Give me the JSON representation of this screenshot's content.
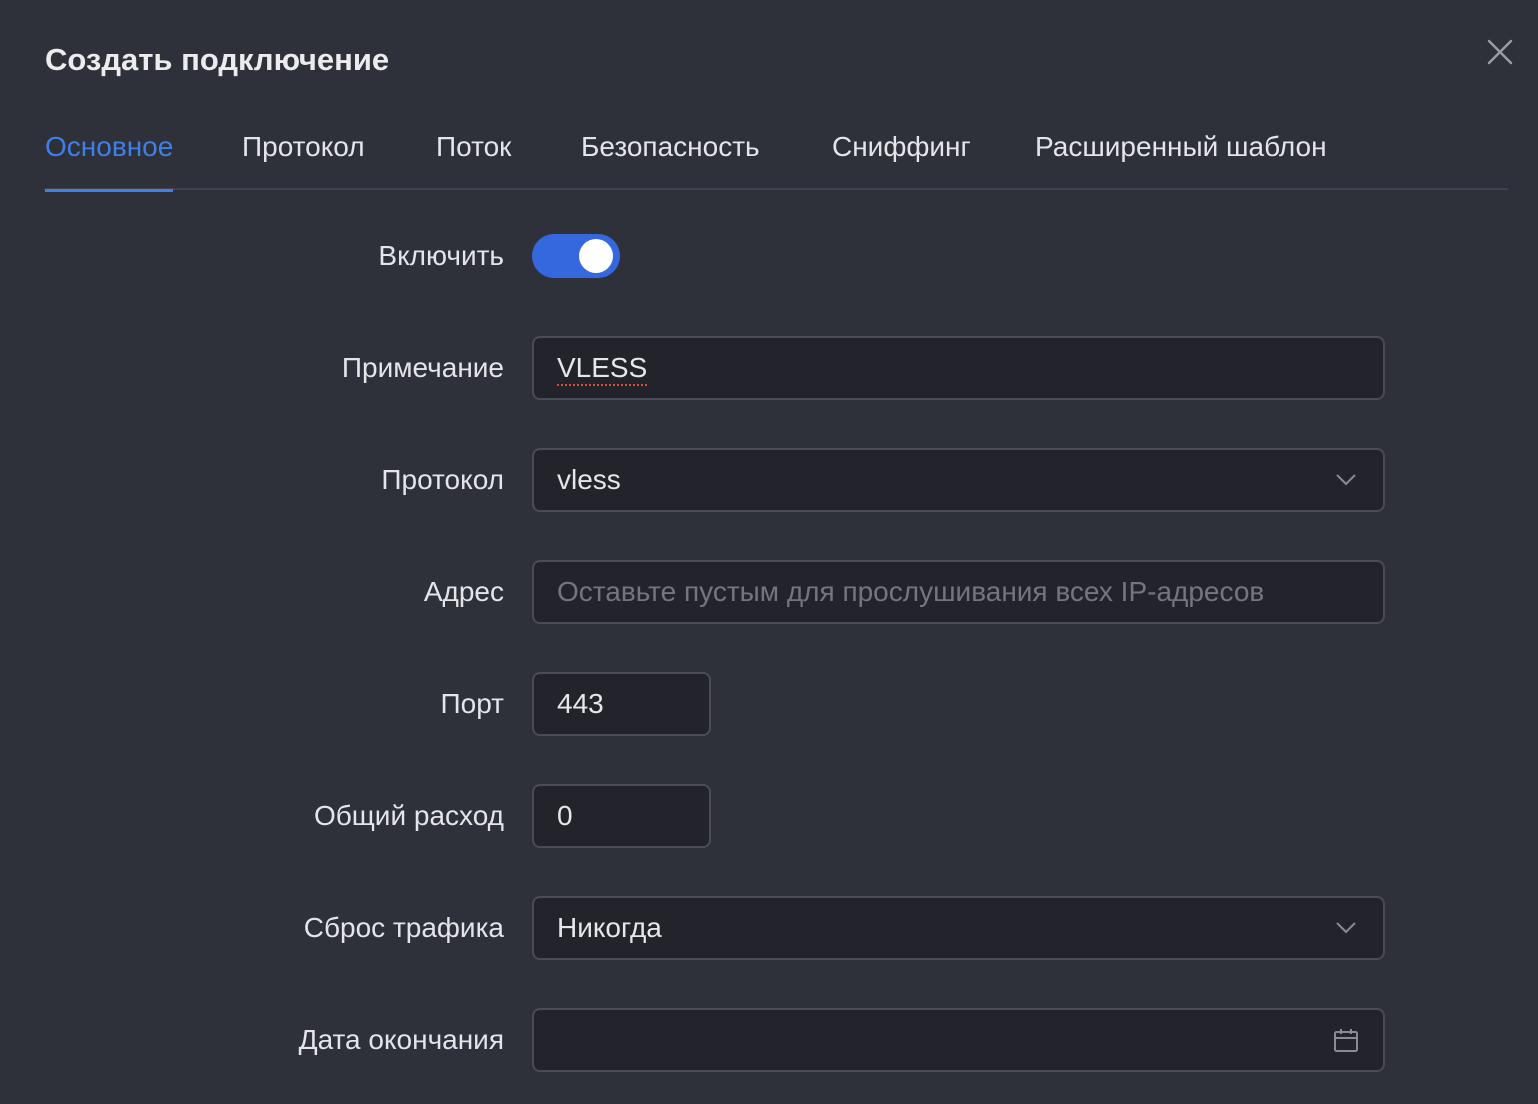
{
  "dialog": {
    "title": "Создать подключение"
  },
  "tabs": [
    {
      "label": "Основное",
      "active": true
    },
    {
      "label": "Протокол",
      "active": false
    },
    {
      "label": "Поток",
      "active": false
    },
    {
      "label": "Безопасность",
      "active": false
    },
    {
      "label": "Сниффинг",
      "active": false
    },
    {
      "label": "Расширенный шаблон",
      "active": false
    }
  ],
  "form": {
    "enable": {
      "label": "Включить",
      "on": true
    },
    "remark": {
      "label": "Примечание",
      "value": "VLESS"
    },
    "protocol": {
      "label": "Протокол",
      "value": "vless"
    },
    "address": {
      "label": "Адрес",
      "value": "",
      "placeholder": "Оставьте пустым для прослушивания всех IP-адресов"
    },
    "port": {
      "label": "Порт",
      "value": "443"
    },
    "total": {
      "label": "Общий расход",
      "value": "0"
    },
    "traffic_reset": {
      "label": "Сброс трафика",
      "value": "Никогда"
    },
    "expiry": {
      "label": "Дата окончания",
      "value": ""
    }
  },
  "icons": {
    "close": "close-icon",
    "select_arrow": "chevron-down-icon",
    "date": "calendar-icon"
  },
  "colors": {
    "accent": "#3f7fe6",
    "toggle_on": "#3568de",
    "background": "#2e303a",
    "input_bg": "#23242b"
  }
}
